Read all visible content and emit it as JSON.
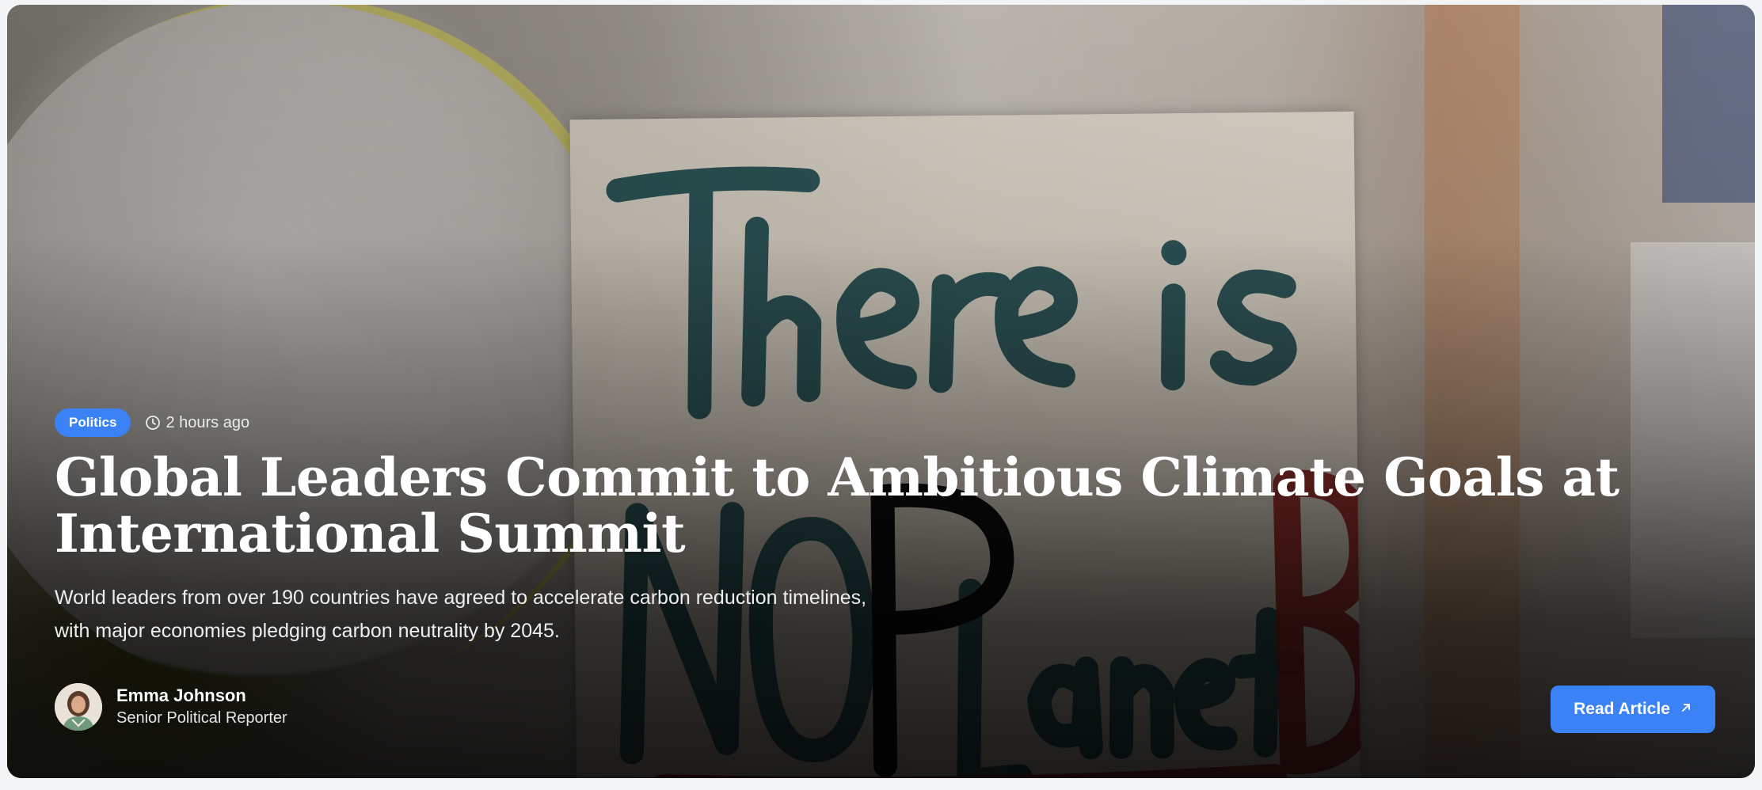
{
  "article": {
    "category": "Politics",
    "time_ago": "2 hours ago",
    "headline": "Global Leaders Commit to Ambitious Climate Goals at International Summit",
    "summary_line1": "World leaders from over 190 countries have agreed to accelerate carbon reduction timelines,",
    "summary_line2": "with major economies pledging carbon neutrality by 2045.",
    "author": {
      "name": "Emma Johnson",
      "role": "Senior Political Reporter"
    },
    "cta_label": "Read Article"
  },
  "hero_image": {
    "sign_text": "There is NO Planet B"
  },
  "colors": {
    "accent": "#3b82f6",
    "text_primary": "#ffffff"
  },
  "icons": {
    "time": "clock-icon",
    "cta": "arrow-up-right-icon"
  }
}
